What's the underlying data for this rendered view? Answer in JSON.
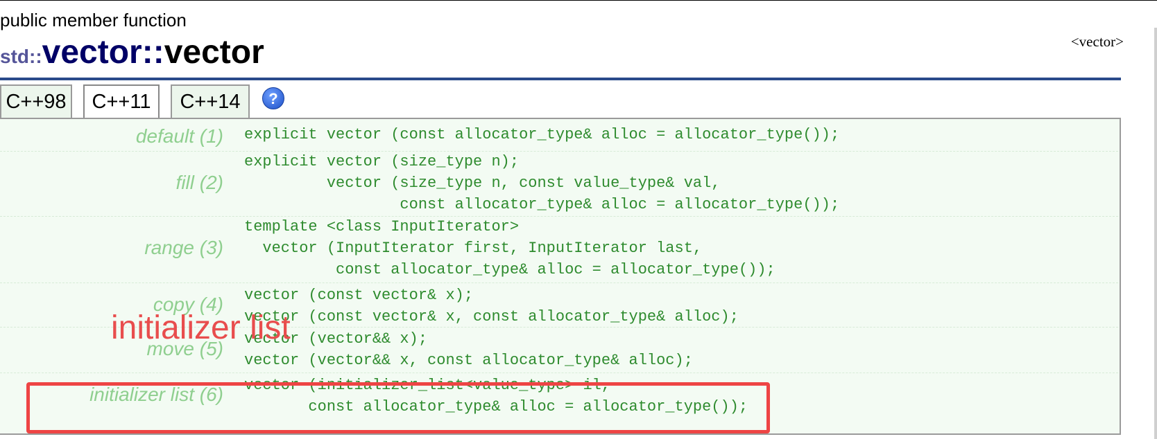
{
  "header": {
    "kind": "public member function",
    "namespace": "std::",
    "class_name": "vector",
    "separator": "::",
    "function_name": "vector",
    "library": "<vector>"
  },
  "tabs": [
    {
      "label": "C++98",
      "active": false
    },
    {
      "label": "C++11",
      "active": true
    },
    {
      "label": "C++14",
      "active": false
    }
  ],
  "help_icon": "question-mark-icon",
  "help_glyph": "?",
  "signatures": [
    {
      "label": "default (1)",
      "code": "explicit vector (const allocator_type& alloc = allocator_type());"
    },
    {
      "label": "fill (2)",
      "code": "explicit vector (size_type n);\n         vector (size_type n, const value_type& val,\n                 const allocator_type& alloc = allocator_type());"
    },
    {
      "label": "range (3)",
      "code": "template <class InputIterator>\n  vector (InputIterator first, InputIterator last,\n          const allocator_type& alloc = allocator_type());"
    },
    {
      "label": "copy (4)",
      "code": "vector (const vector& x);\nvector (const vector& x, const allocator_type& alloc);"
    },
    {
      "label": "move (5)",
      "code": "vector (vector&& x);\nvector (vector&& x, const allocator_type& alloc);"
    },
    {
      "label": "initializer list (6)",
      "code": "vector (initializer_list<value_type> il,\n       const allocator_type& alloc = allocator_type());"
    }
  ],
  "annotation": {
    "text": "initializer list",
    "color": "#e84d4d"
  },
  "colors": {
    "code": "#2e8b2e",
    "label": "#8fcf8f",
    "panel_bg": "#f3fbf3",
    "title_blue": "#000066"
  }
}
